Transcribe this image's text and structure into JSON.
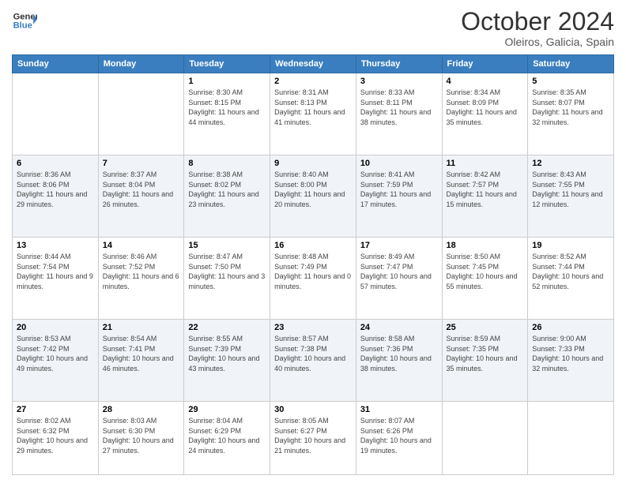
{
  "header": {
    "logo_line1": "General",
    "logo_line2": "Blue",
    "month": "October 2024",
    "location": "Oleiros, Galicia, Spain"
  },
  "weekdays": [
    "Sunday",
    "Monday",
    "Tuesday",
    "Wednesday",
    "Thursday",
    "Friday",
    "Saturday"
  ],
  "weeks": [
    [
      {
        "day": "",
        "sunrise": "",
        "sunset": "",
        "daylight": ""
      },
      {
        "day": "",
        "sunrise": "",
        "sunset": "",
        "daylight": ""
      },
      {
        "day": "1",
        "sunrise": "Sunrise: 8:30 AM",
        "sunset": "Sunset: 8:15 PM",
        "daylight": "Daylight: 11 hours and 44 minutes."
      },
      {
        "day": "2",
        "sunrise": "Sunrise: 8:31 AM",
        "sunset": "Sunset: 8:13 PM",
        "daylight": "Daylight: 11 hours and 41 minutes."
      },
      {
        "day": "3",
        "sunrise": "Sunrise: 8:33 AM",
        "sunset": "Sunset: 8:11 PM",
        "daylight": "Daylight: 11 hours and 38 minutes."
      },
      {
        "day": "4",
        "sunrise": "Sunrise: 8:34 AM",
        "sunset": "Sunset: 8:09 PM",
        "daylight": "Daylight: 11 hours and 35 minutes."
      },
      {
        "day": "5",
        "sunrise": "Sunrise: 8:35 AM",
        "sunset": "Sunset: 8:07 PM",
        "daylight": "Daylight: 11 hours and 32 minutes."
      }
    ],
    [
      {
        "day": "6",
        "sunrise": "Sunrise: 8:36 AM",
        "sunset": "Sunset: 8:06 PM",
        "daylight": "Daylight: 11 hours and 29 minutes."
      },
      {
        "day": "7",
        "sunrise": "Sunrise: 8:37 AM",
        "sunset": "Sunset: 8:04 PM",
        "daylight": "Daylight: 11 hours and 26 minutes."
      },
      {
        "day": "8",
        "sunrise": "Sunrise: 8:38 AM",
        "sunset": "Sunset: 8:02 PM",
        "daylight": "Daylight: 11 hours and 23 minutes."
      },
      {
        "day": "9",
        "sunrise": "Sunrise: 8:40 AM",
        "sunset": "Sunset: 8:00 PM",
        "daylight": "Daylight: 11 hours and 20 minutes."
      },
      {
        "day": "10",
        "sunrise": "Sunrise: 8:41 AM",
        "sunset": "Sunset: 7:59 PM",
        "daylight": "Daylight: 11 hours and 17 minutes."
      },
      {
        "day": "11",
        "sunrise": "Sunrise: 8:42 AM",
        "sunset": "Sunset: 7:57 PM",
        "daylight": "Daylight: 11 hours and 15 minutes."
      },
      {
        "day": "12",
        "sunrise": "Sunrise: 8:43 AM",
        "sunset": "Sunset: 7:55 PM",
        "daylight": "Daylight: 11 hours and 12 minutes."
      }
    ],
    [
      {
        "day": "13",
        "sunrise": "Sunrise: 8:44 AM",
        "sunset": "Sunset: 7:54 PM",
        "daylight": "Daylight: 11 hours and 9 minutes."
      },
      {
        "day": "14",
        "sunrise": "Sunrise: 8:46 AM",
        "sunset": "Sunset: 7:52 PM",
        "daylight": "Daylight: 11 hours and 6 minutes."
      },
      {
        "day": "15",
        "sunrise": "Sunrise: 8:47 AM",
        "sunset": "Sunset: 7:50 PM",
        "daylight": "Daylight: 11 hours and 3 minutes."
      },
      {
        "day": "16",
        "sunrise": "Sunrise: 8:48 AM",
        "sunset": "Sunset: 7:49 PM",
        "daylight": "Daylight: 11 hours and 0 minutes."
      },
      {
        "day": "17",
        "sunrise": "Sunrise: 8:49 AM",
        "sunset": "Sunset: 7:47 PM",
        "daylight": "Daylight: 10 hours and 57 minutes."
      },
      {
        "day": "18",
        "sunrise": "Sunrise: 8:50 AM",
        "sunset": "Sunset: 7:45 PM",
        "daylight": "Daylight: 10 hours and 55 minutes."
      },
      {
        "day": "19",
        "sunrise": "Sunrise: 8:52 AM",
        "sunset": "Sunset: 7:44 PM",
        "daylight": "Daylight: 10 hours and 52 minutes."
      }
    ],
    [
      {
        "day": "20",
        "sunrise": "Sunrise: 8:53 AM",
        "sunset": "Sunset: 7:42 PM",
        "daylight": "Daylight: 10 hours and 49 minutes."
      },
      {
        "day": "21",
        "sunrise": "Sunrise: 8:54 AM",
        "sunset": "Sunset: 7:41 PM",
        "daylight": "Daylight: 10 hours and 46 minutes."
      },
      {
        "day": "22",
        "sunrise": "Sunrise: 8:55 AM",
        "sunset": "Sunset: 7:39 PM",
        "daylight": "Daylight: 10 hours and 43 minutes."
      },
      {
        "day": "23",
        "sunrise": "Sunrise: 8:57 AM",
        "sunset": "Sunset: 7:38 PM",
        "daylight": "Daylight: 10 hours and 40 minutes."
      },
      {
        "day": "24",
        "sunrise": "Sunrise: 8:58 AM",
        "sunset": "Sunset: 7:36 PM",
        "daylight": "Daylight: 10 hours and 38 minutes."
      },
      {
        "day": "25",
        "sunrise": "Sunrise: 8:59 AM",
        "sunset": "Sunset: 7:35 PM",
        "daylight": "Daylight: 10 hours and 35 minutes."
      },
      {
        "day": "26",
        "sunrise": "Sunrise: 9:00 AM",
        "sunset": "Sunset: 7:33 PM",
        "daylight": "Daylight: 10 hours and 32 minutes."
      }
    ],
    [
      {
        "day": "27",
        "sunrise": "Sunrise: 8:02 AM",
        "sunset": "Sunset: 6:32 PM",
        "daylight": "Daylight: 10 hours and 29 minutes."
      },
      {
        "day": "28",
        "sunrise": "Sunrise: 8:03 AM",
        "sunset": "Sunset: 6:30 PM",
        "daylight": "Daylight: 10 hours and 27 minutes."
      },
      {
        "day": "29",
        "sunrise": "Sunrise: 8:04 AM",
        "sunset": "Sunset: 6:29 PM",
        "daylight": "Daylight: 10 hours and 24 minutes."
      },
      {
        "day": "30",
        "sunrise": "Sunrise: 8:05 AM",
        "sunset": "Sunset: 6:27 PM",
        "daylight": "Daylight: 10 hours and 21 minutes."
      },
      {
        "day": "31",
        "sunrise": "Sunrise: 8:07 AM",
        "sunset": "Sunset: 6:26 PM",
        "daylight": "Daylight: 10 hours and 19 minutes."
      },
      {
        "day": "",
        "sunrise": "",
        "sunset": "",
        "daylight": ""
      },
      {
        "day": "",
        "sunrise": "",
        "sunset": "",
        "daylight": ""
      }
    ]
  ]
}
